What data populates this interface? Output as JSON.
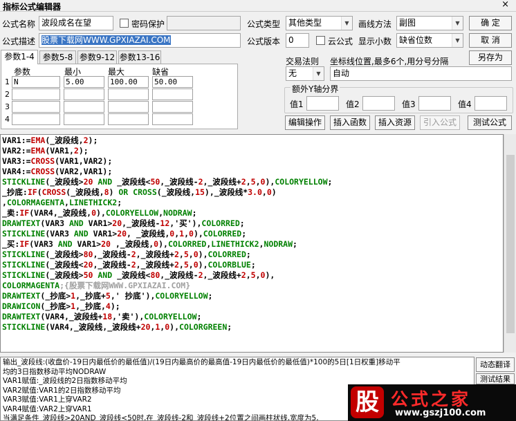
{
  "window": {
    "title": "指标公式编辑器",
    "close": "×"
  },
  "form": {
    "name_label": "公式名称",
    "name_value": "波段成名在望",
    "password_label": "密码保护",
    "type_label": "公式类型",
    "type_value": "其他类型",
    "draw_label": "画线方法",
    "draw_value": "副图",
    "confirm": "确 定",
    "desc_label": "公式描述",
    "desc_value": "股票下载网WWW.GPXIAZAI.COM",
    "version_label": "公式版本",
    "version_value": "0",
    "cloud_label": "云公式",
    "decimal_label": "显示小数",
    "decimal_value": "缺省位数",
    "cancel": "取 消",
    "saveas": "另存为"
  },
  "tabs": [
    "参数1-4",
    "参数5-8",
    "参数9-12",
    "参数13-16"
  ],
  "params": {
    "headers": [
      "参数",
      "最小",
      "最大",
      "缺省"
    ],
    "rows": [
      {
        "n": "1",
        "name": "N",
        "min": "5.00",
        "max": "100.00",
        "def": "50.00"
      },
      {
        "n": "2",
        "name": "",
        "min": "",
        "max": "",
        "def": ""
      },
      {
        "n": "3",
        "name": "",
        "min": "",
        "max": "",
        "def": ""
      },
      {
        "n": "4",
        "name": "",
        "min": "",
        "max": "",
        "def": ""
      }
    ]
  },
  "trade": {
    "label": "交易法则",
    "value": "无"
  },
  "coord": {
    "label": "坐标线位置,最多6个,用分号分隔",
    "value": "自动"
  },
  "yaxis": {
    "title": "额外Y轴分界",
    "labels": [
      "值1",
      "值2",
      "值3",
      "值4"
    ]
  },
  "actions": [
    "编辑操作",
    "插入函数",
    "插入资源",
    "引入公式",
    "测试公式"
  ],
  "code": [
    [
      [
        "VAR1:=",
        "#000000"
      ],
      [
        "EMA",
        "#c00000"
      ],
      [
        "(_波段线,",
        "#000000"
      ],
      [
        "2",
        "#c00000"
      ],
      [
        ");",
        "#000000"
      ]
    ],
    [
      [
        "VAR2:=",
        "#000000"
      ],
      [
        "EMA",
        "#c00000"
      ],
      [
        "(VAR1,",
        "#000000"
      ],
      [
        "2",
        "#c00000"
      ],
      [
        ");",
        "#000000"
      ]
    ],
    [
      [
        "VAR3:=",
        "#000000"
      ],
      [
        "CROSS",
        "#c00000"
      ],
      [
        "(VAR1,VAR2);",
        "#000000"
      ]
    ],
    [
      [
        "VAR4:=",
        "#000000"
      ],
      [
        "CROSS",
        "#c00000"
      ],
      [
        "(VAR2,VAR1);",
        "#000000"
      ]
    ],
    [
      [
        "STICKLINE",
        "#008000"
      ],
      [
        "(_波段线>",
        "#000000"
      ],
      [
        "20",
        "#c00000"
      ],
      [
        " AND ",
        "#008000"
      ],
      [
        "_波段线<",
        "#000000"
      ],
      [
        "50",
        "#c00000"
      ],
      [
        ",_波段线-",
        "#000000"
      ],
      [
        "2",
        "#c00000"
      ],
      [
        ",_波段线+",
        "#000000"
      ],
      [
        "2",
        "#c00000"
      ],
      [
        ",",
        "#000000"
      ],
      [
        "5",
        "#c00000"
      ],
      [
        ",",
        "#000000"
      ],
      [
        "0",
        "#c00000"
      ],
      [
        "),",
        "#000000"
      ],
      [
        "COLORYELLOW",
        "#008000"
      ],
      [
        ";",
        "#000000"
      ]
    ],
    [
      [
        "_抄底:",
        "#000000"
      ],
      [
        "IF",
        "#c00000"
      ],
      [
        "(",
        "#000000"
      ],
      [
        "CROSS",
        "#c00000"
      ],
      [
        "(_波段线,",
        "#000000"
      ],
      [
        "8",
        "#c00000"
      ],
      [
        ") ",
        "#000000"
      ],
      [
        "OR",
        "#008000"
      ],
      [
        " ",
        "#000000"
      ],
      [
        "CROSS",
        "#008000"
      ],
      [
        "(_波段线,",
        "#000000"
      ],
      [
        "15",
        "#c00000"
      ],
      [
        "),_波段线*",
        "#000000"
      ],
      [
        "3.0",
        "#c00000"
      ],
      [
        ",",
        "#000000"
      ],
      [
        "0",
        "#c00000"
      ],
      [
        ")",
        "#000000"
      ]
    ],
    [
      [
        ",",
        "#000000"
      ],
      [
        "COLORMAGENTA",
        "#008000"
      ],
      [
        ",",
        "#000000"
      ],
      [
        "LINETHICK2",
        "#008000"
      ],
      [
        ";",
        "#000000"
      ]
    ],
    [
      [
        "_卖:",
        "#000000"
      ],
      [
        "IF",
        "#c00000"
      ],
      [
        "(VAR4,_波段线,",
        "#000000"
      ],
      [
        "0",
        "#c00000"
      ],
      [
        "),",
        "#000000"
      ],
      [
        "COLORYELLOW",
        "#008000"
      ],
      [
        ",",
        "#000000"
      ],
      [
        "NODRAW",
        "#008000"
      ],
      [
        ";",
        "#000000"
      ]
    ],
    [
      [
        "DRAWTEXT",
        "#008000"
      ],
      [
        "(VAR3 ",
        "#000000"
      ],
      [
        "AND",
        "#008000"
      ],
      [
        " VAR1>",
        "#000000"
      ],
      [
        "20",
        "#c00000"
      ],
      [
        ",_波段线-",
        "#000000"
      ],
      [
        "12",
        "#c00000"
      ],
      [
        ",'买'),",
        "#000000"
      ],
      [
        "COLORRED",
        "#008000"
      ],
      [
        ";",
        "#000000"
      ]
    ],
    [
      [
        "STICKLINE",
        "#008000"
      ],
      [
        "(VAR3 ",
        "#000000"
      ],
      [
        "AND",
        "#008000"
      ],
      [
        " VAR1>",
        "#000000"
      ],
      [
        "20",
        "#c00000"
      ],
      [
        ", _波段线,",
        "#000000"
      ],
      [
        "0",
        "#c00000"
      ],
      [
        ",",
        "#000000"
      ],
      [
        "1",
        "#c00000"
      ],
      [
        ",",
        "#000000"
      ],
      [
        "0",
        "#c00000"
      ],
      [
        "),",
        "#000000"
      ],
      [
        "COLORRED",
        "#008000"
      ],
      [
        ";",
        "#000000"
      ]
    ],
    [
      [
        "_买:",
        "#000000"
      ],
      [
        "IF",
        "#c00000"
      ],
      [
        "(VAR3 ",
        "#000000"
      ],
      [
        "AND",
        "#008000"
      ],
      [
        " VAR1>",
        "#000000"
      ],
      [
        "20",
        "#c00000"
      ],
      [
        " ,_波段线,",
        "#000000"
      ],
      [
        "0",
        "#c00000"
      ],
      [
        "),",
        "#000000"
      ],
      [
        "COLORRED",
        "#008000"
      ],
      [
        ",",
        "#000000"
      ],
      [
        "LINETHICK2",
        "#008000"
      ],
      [
        ",",
        "#000000"
      ],
      [
        "NODRAW",
        "#008000"
      ],
      [
        ";",
        "#000000"
      ]
    ],
    [
      [
        "STICKLINE",
        "#008000"
      ],
      [
        "(_波段线>",
        "#000000"
      ],
      [
        "80",
        "#c00000"
      ],
      [
        ",_波段线-",
        "#000000"
      ],
      [
        "2",
        "#c00000"
      ],
      [
        ",_波段线+",
        "#000000"
      ],
      [
        "2",
        "#c00000"
      ],
      [
        ",",
        "#000000"
      ],
      [
        "5",
        "#c00000"
      ],
      [
        ",",
        "#000000"
      ],
      [
        "0",
        "#c00000"
      ],
      [
        "),",
        "#000000"
      ],
      [
        "COLORRED",
        "#008000"
      ],
      [
        ";",
        "#000000"
      ]
    ],
    [
      [
        "STICKLINE",
        "#008000"
      ],
      [
        "(_波段线<",
        "#000000"
      ],
      [
        "20",
        "#c00000"
      ],
      [
        ",_波段线-",
        "#000000"
      ],
      [
        "2",
        "#c00000"
      ],
      [
        ",_波段线+",
        "#000000"
      ],
      [
        "2",
        "#c00000"
      ],
      [
        ",",
        "#000000"
      ],
      [
        "5",
        "#c00000"
      ],
      [
        ",",
        "#000000"
      ],
      [
        "0",
        "#c00000"
      ],
      [
        "),",
        "#000000"
      ],
      [
        "COLORBLUE",
        "#008000"
      ],
      [
        ";",
        "#000000"
      ]
    ],
    [
      [
        "STICKLINE",
        "#008000"
      ],
      [
        "(_波段线>",
        "#000000"
      ],
      [
        "50",
        "#c00000"
      ],
      [
        " AND ",
        "#008000"
      ],
      [
        "_波段线<",
        "#000000"
      ],
      [
        "80",
        "#c00000"
      ],
      [
        ",_波段线-",
        "#000000"
      ],
      [
        "2",
        "#c00000"
      ],
      [
        ",_波段线+",
        "#000000"
      ],
      [
        "2",
        "#c00000"
      ],
      [
        ",",
        "#000000"
      ],
      [
        "5",
        "#c00000"
      ],
      [
        ",",
        "#000000"
      ],
      [
        "0",
        "#c00000"
      ],
      [
        "),",
        "#000000"
      ]
    ],
    [
      [
        "COLORMAGENTA",
        "#008000"
      ],
      [
        ";{股票下载网WWW.GPXIAZAI.COM}",
        "#a0a0a0"
      ]
    ],
    [
      [
        "DRAWTEXT",
        "#008000"
      ],
      [
        "(_抄底>",
        "#000000"
      ],
      [
        "1",
        "#c00000"
      ],
      [
        ",_抄底+",
        "#000000"
      ],
      [
        "5",
        "#c00000"
      ],
      [
        ",' 抄底'),",
        "#000000"
      ],
      [
        "COLORYELLOW",
        "#008000"
      ],
      [
        ";",
        "#000000"
      ]
    ],
    [
      [
        "DRAWICON",
        "#008000"
      ],
      [
        "(_抄底>",
        "#000000"
      ],
      [
        "1",
        "#c00000"
      ],
      [
        ",_抄底,",
        "#000000"
      ],
      [
        "4",
        "#c00000"
      ],
      [
        ");",
        "#000000"
      ]
    ],
    [
      [
        "DRAWTEXT",
        "#008000"
      ],
      [
        "(VAR4,_波段线+",
        "#000000"
      ],
      [
        "18",
        "#c00000"
      ],
      [
        ",'卖'),",
        "#000000"
      ],
      [
        "COLORYELLOW",
        "#008000"
      ],
      [
        ";",
        "#000000"
      ]
    ],
    [
      [
        "STICKLINE",
        "#008000"
      ],
      [
        "(VAR4,_波段线,_波段线+",
        "#000000"
      ],
      [
        "20",
        "#c00000"
      ],
      [
        ",",
        "#000000"
      ],
      [
        "1",
        "#c00000"
      ],
      [
        ",",
        "#000000"
      ],
      [
        "0",
        "#c00000"
      ],
      [
        "),",
        "#000000"
      ],
      [
        "COLORGREEN",
        "#008000"
      ],
      [
        ";",
        "#000000"
      ]
    ]
  ],
  "output": [
    "输出_波段线:(收盘价-19日内最低价的最低值)/(19日内最高价的最高值-19日内最低价的最低值)*100的5日[1日权重]移动平",
    "均的3日指数移动平均NODRAW",
    "VAR1赋值:_波段线的2日指数移动平均",
    "VAR2赋值:VAR1的2日指数移动平均",
    "VAR3赋值:VAR1上穿VAR2",
    "VAR4赋值:VAR2上穿VAR1",
    "当满足条件_波段线>20AND_波段线<50时,在_波段线-2和_波段线+2位置之间画柱状线,宽度为5,"
  ],
  "side_buttons": [
    "动态翻译",
    "测试结果"
  ],
  "logo": {
    "char": "股",
    "text": "公式之家",
    "url": "www.gszj100.com"
  }
}
